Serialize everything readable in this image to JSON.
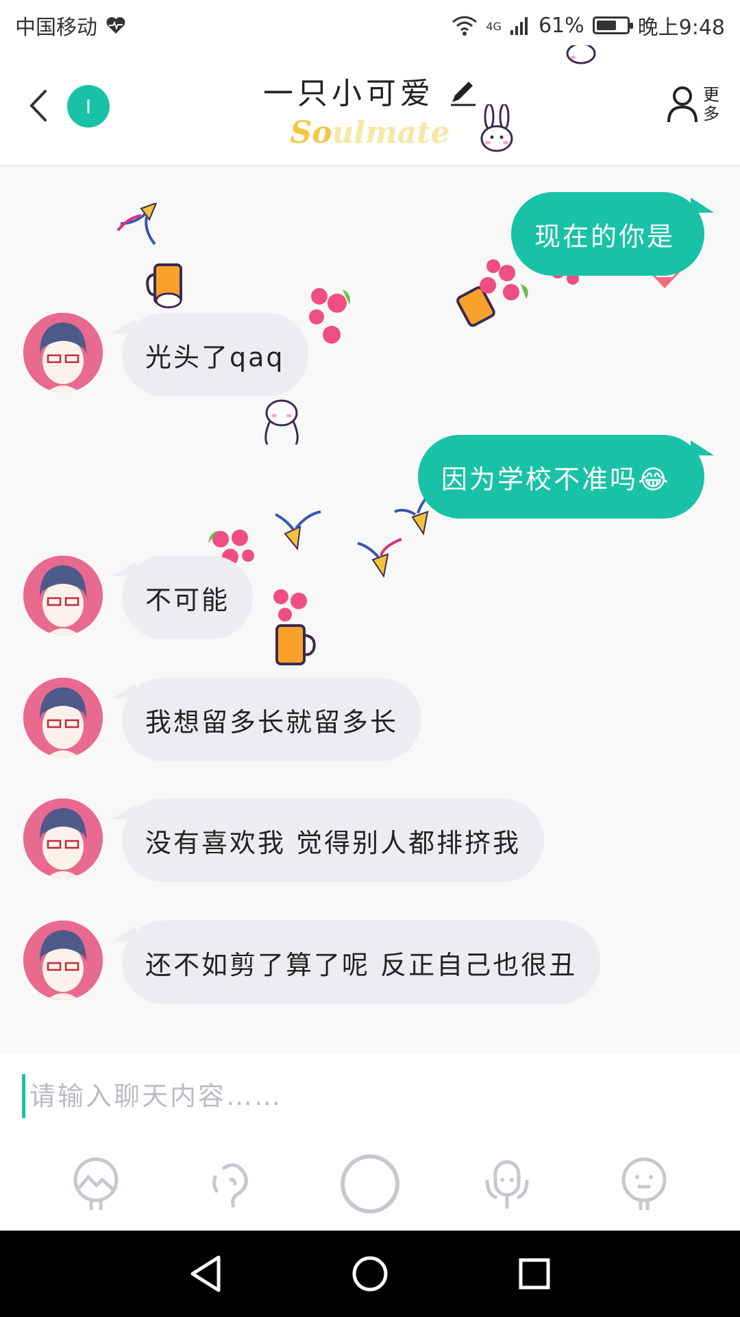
{
  "status_bar": {
    "carrier": "中国移动",
    "network": "4G",
    "battery": "61%",
    "battery_level": 0.61,
    "time": "晚上9:48"
  },
  "header": {
    "status_letter": "I",
    "title": "一只小可爱",
    "subtitle_so": "So",
    "subtitle_rest": "ulmate",
    "more_label": "更多"
  },
  "messages": [
    {
      "side": "right",
      "text": "现在的你是"
    },
    {
      "side": "left",
      "text": "光头了qaq"
    },
    {
      "side": "right",
      "text": "因为学校不准吗😂"
    },
    {
      "side": "left",
      "text": "不可能"
    },
    {
      "side": "left",
      "text": "我想留多长就留多长"
    },
    {
      "side": "left",
      "text": "没有喜欢我 觉得别人都排挤我"
    },
    {
      "side": "left",
      "text": "还不如剪了算了呢 反正自己也很丑"
    }
  ],
  "input": {
    "placeholder": "请输入聊天内容……",
    "value": ""
  },
  "toolbar": [
    "image-icon",
    "voice-icon",
    "camera-icon",
    "mic-icon",
    "emoji-icon"
  ],
  "colors": {
    "accent": "#19c2a6",
    "left_bubble": "#ebedf0",
    "avatar_bg": "#e96a8f",
    "subtitle": "#f3c847"
  }
}
